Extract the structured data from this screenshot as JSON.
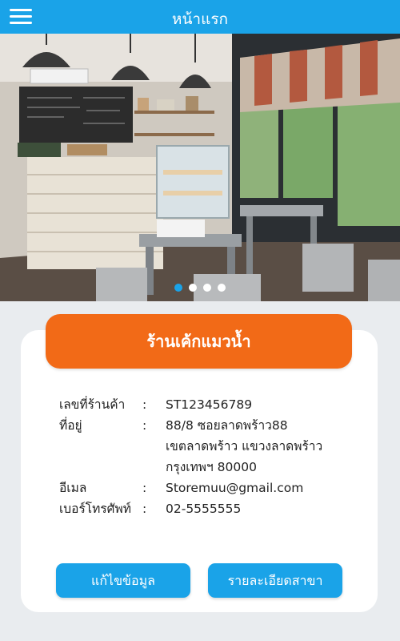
{
  "header": {
    "title": "หน้าแรก",
    "menu_icon": "hamburger-menu-icon"
  },
  "carousel": {
    "slide_count": 4,
    "active_index": 0
  },
  "store": {
    "name": "ร้านเค้กแมวน้ำ",
    "fields": {
      "store_id": {
        "label": "เลขที่ร้านค้า",
        "value": "ST123456789"
      },
      "address": {
        "label": "ที่อยู่",
        "lines": [
          "88/8 ซอยลาดพร้าว88",
          "เขตลาดพร้าว แขวงลาดพร้าว",
          "กรุงเทพฯ 80000"
        ]
      },
      "email": {
        "label": "อีเมล",
        "value": "Storemuu@gmail.com"
      },
      "phone": {
        "label": "เบอร์โทรศัพท์",
        "value": "02-5555555"
      }
    },
    "separator": ":"
  },
  "actions": {
    "edit_label": "แก้ไขข้อมูล",
    "branch_label": "รายละเอียดสาขา"
  },
  "colors": {
    "primary": "#1aa3e8",
    "accent": "#f26a17",
    "background": "#e9ecef"
  }
}
